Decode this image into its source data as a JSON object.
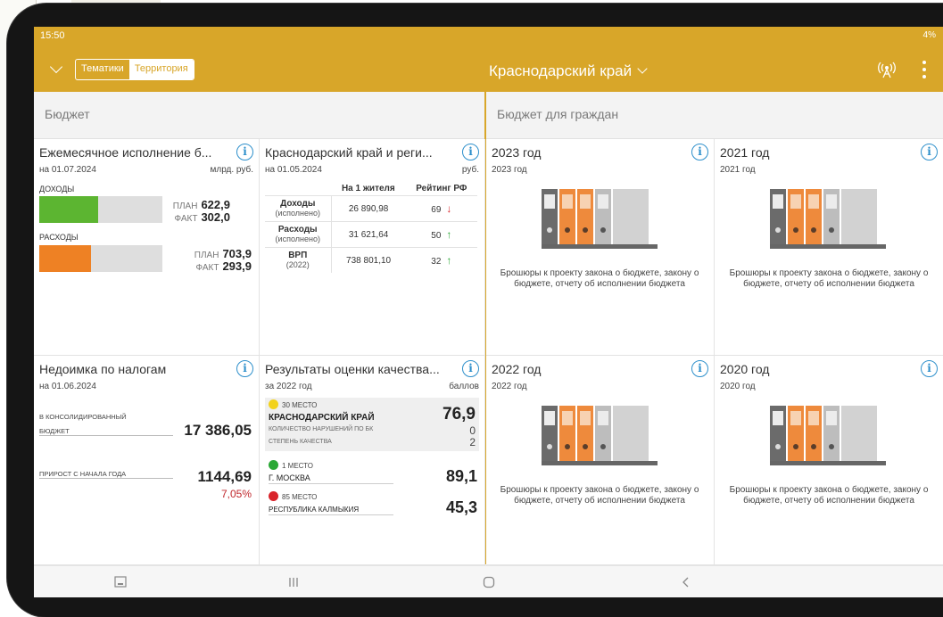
{
  "status_bar": {
    "time": "15:50",
    "right": "4%"
  },
  "header": {
    "tabs": [
      {
        "label": "Тематики",
        "active": false
      },
      {
        "label": "Территория",
        "active": true
      }
    ],
    "region": "Краснодарский край"
  },
  "sections": {
    "left": "Бюджет",
    "right": "Бюджет для граждан"
  },
  "monthly": {
    "title": "Ежемесячное исполнение б...",
    "date": "на 01.07.2024",
    "unit": "млрд. руб.",
    "income": {
      "label": "ДОХОДЫ",
      "plan_label": "ПЛАН",
      "plan": "622,9",
      "fact_label": "ФАКТ",
      "fact": "302,0",
      "fill_fraction": 0.48,
      "color": "#5cb531"
    },
    "expense": {
      "label": "РАСХОДЫ",
      "plan_label": "ПЛАН",
      "plan": "703,9",
      "fact_label": "ФАКТ",
      "fact": "293,9",
      "fill_fraction": 0.42,
      "color": "#ee8124"
    }
  },
  "region_card": {
    "title": "Краснодарский край и реги...",
    "date": "на 01.05.2024",
    "unit": "руб.",
    "col1": "На 1 жителя",
    "col2": "Рейтинг РФ",
    "rows": [
      {
        "name": "Доходы",
        "sub": "(исполнено)",
        "value": "26 890,98",
        "rank": "69",
        "trend": "down"
      },
      {
        "name": "Расходы",
        "sub": "(исполнено)",
        "value": "31 621,64",
        "rank": "50",
        "trend": "up"
      },
      {
        "name": "ВРП",
        "sub": "(2022)",
        "value": "738 801,10",
        "rank": "32",
        "trend": "up"
      }
    ]
  },
  "brochures": [
    {
      "title": "2023 год",
      "sub": "2023 год",
      "caption": "Брошюры к проекту закона о бюджете, закону о бюджете, отчету об исполнении бюджета"
    },
    {
      "title": "2021 год",
      "sub": "2021 год",
      "caption": "Брошюры к проекту закона о бюджете, закону о бюджете, отчету об исполнении бюджета"
    },
    {
      "title": "2022 год",
      "sub": "2022 год",
      "caption": "Брошюры к проекту закона о бюджете, закону о бюджете, отчету об исполнении бюджета"
    },
    {
      "title": "2020 год",
      "sub": "2020 год",
      "caption": "Брошюры к проекту закона о бюджете, закону о бюджете, отчету об исполнении бюджета"
    }
  ],
  "arrears": {
    "title": "Недоимка по налогам",
    "date": "на 01.06.2024",
    "label1a": "В КОНСОЛИДИРОВАННЫЙ",
    "label1b": "БЮДЖЕТ",
    "value1": "17 386,05",
    "label2": "ПРИРОСТ С НАЧАЛА ГОДА",
    "value2": "1144,69",
    "percent": "7,05%"
  },
  "quality": {
    "title": "Результаты оценки качества...",
    "date": "за 2022 год",
    "unit": "баллов",
    "main": {
      "place": "30 МЕСТО",
      "name": "КРАСНОДАРСКИЙ КРАЙ",
      "score": "76,9",
      "violations_label": "КОЛИЧЕСТВО НАРУШЕНИЙ ПО БК",
      "violations": "0",
      "degree_label": "СТЕПЕНЬ КАЧЕСТВА",
      "degree": "2",
      "color": "#f2d21c"
    },
    "best": {
      "place": "1 МЕСТО",
      "name": "Г. МОСКВА",
      "score": "89,1",
      "color": "#2aa835"
    },
    "worst": {
      "place": "85 МЕСТО",
      "name": "РЕСПУБЛИКА КАЛМЫКИЯ",
      "score": "45,3",
      "color": "#d9242b"
    }
  },
  "colors": {
    "accent": "#d8a629",
    "info": "#2d8fcb"
  }
}
